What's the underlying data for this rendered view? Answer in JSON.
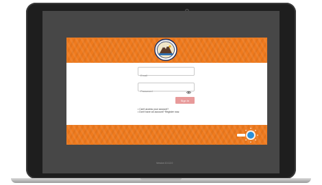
{
  "login": {
    "email_placeholder": "Email",
    "password_placeholder": "Password",
    "signin_label": "Sign In",
    "links": [
      "Can't access your account?",
      "Don't have an account? Register now."
    ]
  },
  "footer": {
    "version": "Version 10.12.0"
  },
  "colors": {
    "brand_orange": "#ef7a1d",
    "signin_button": "#e89a9a",
    "screen_bezel": "#474747"
  },
  "icons": [
    "seal-logo-icon",
    "eye-icon",
    "brand-logo-icon"
  ]
}
